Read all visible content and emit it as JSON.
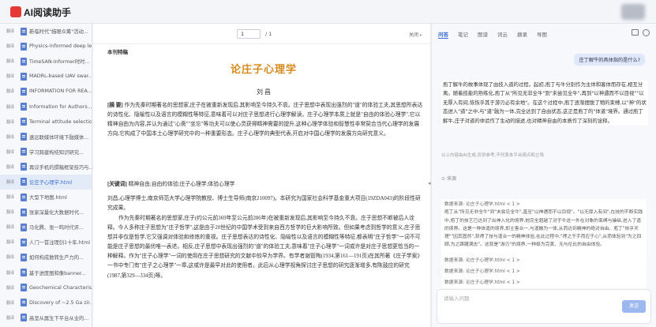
{
  "app": {
    "title": "AI阅读助手"
  },
  "sidebar": {
    "items": [
      {
        "tag": "翻译",
        "label": "新临时代\"描眼众筹\"活动..."
      },
      {
        "tag": "翻译",
        "label": "Physics-informed deep le..."
      },
      {
        "tag": "翻译",
        "label": "TimeSAN-Informer时时..."
      },
      {
        "tag": "翻译",
        "label": "MADRL-based UAV swar..."
      },
      {
        "tag": "翻译",
        "label": "INFORMATION FOR REA..."
      },
      {
        "tag": "翻译",
        "label": "Information for Authors..."
      },
      {
        "tag": "翻译",
        "label": "Terminal attitude selectio..."
      },
      {
        "tag": "翻译",
        "label": "速远联媒体环境下融媒体..."
      },
      {
        "tag": "翻译",
        "label": "学习跨建构结知识研究..."
      },
      {
        "tag": "翻译",
        "label": "再议手机的撰稿框架技巧与..."
      },
      {
        "tag": "翻译",
        "label": "论庄子心理学.html",
        "active": true
      },
      {
        "tag": "翻译",
        "label": "大型下地图.html"
      },
      {
        "tag": "翻译",
        "label": "张家深量化大数据时代..."
      },
      {
        "tag": "翻译",
        "label": "马化腾、张一鸣时代评..."
      },
      {
        "tag": "翻译",
        "label": "人门一首注理剑1十年.html"
      },
      {
        "tag": "翻译",
        "label": "如何构成数转生产力的..."
      },
      {
        "tag": "翻译",
        "label": "基于进度图和像banner..."
      },
      {
        "tag": "翻译",
        "label": "Geochemical Characteris..."
      },
      {
        "tag": "翻译",
        "label": "Discovery of ~2.5 Ga zir..."
      },
      {
        "tag": "翻译",
        "label": "高坚从属生下平台从业的..."
      }
    ]
  },
  "document": {
    "page_current": "1",
    "page_total": "/ 1",
    "close_label": "关闭",
    "journal": "本刊特稿",
    "title": "论庄子心理学",
    "author": "刘 昌",
    "abstract_label": "[摘 要]",
    "abstract": "作为先秦时期著名的思想家,庄子在被重新发现后,其影响至今持久不衰。庄子思想中表现出强烈的\"道\"的体验工夫,其思想所表达的诗性化、隐喻性以及语言的模糊性等特征,意味着可以对庄子思想进行心理学解读。庄子心理学本质上就是\"自由的体验心理学\",它以精神自由为内容,并认为通过\"心斋\"\"坐忘\"等功夫可以使心灵获得精神需要的提升,这种心理学体验和智慧性非常契合当代心理学的发展方向,它构成了中国本土心理学研究中的一种重要形态。庄子心理学的典型代表,开启对中国心理学的发展方向研究意义。",
    "keywords_label": "[关键词]",
    "keywords": "精神自由;自由的体验;庄子心理学;体验心理学",
    "author_info": "刘昌,心理学博士,南京师范大学心理学院教授、博士生导师(南京210097)。本研究为国家社会科学基金重大项目(19ZDA043)的阶段性研究成果。",
    "body": "作为先秦时期著名的思想家,庄子(约公元前369年至公元前286年)在被重新发现后,其影响至今持久不衰。庄子思想不断被后人诠释。今人多称庄子思想为\"庄子哲学\",这是由于20世纪的中国学术受到来自西方哲学的巨大影响所致。但如果考虑到哲学的意义,庄子思想并非仅是哲学,它又强调对体验和修炼的重视。庄子思想表达的诗性化、隐喻性以及语言的模糊性等特征,都表明\"庄子哲学\"一词不可能是庄子思想的最优唯一表述。相反,庄子思想中表现出强烈的\"道\"的体验工夫,意味着\"庄子心理学\"一词或许是对庄子思想更恰当的一种解释。作为\"庄子心理学\"一词的使用在庄子思想研究的文献中较早为学界。有学者谢管陶(1934,第161—191页)在其所著《庄子学案》一书中专门有\"庄子之心理学\"一章,这或许是最早对此的使用者。此后从心理学视角探讨庄子思想的研究逐渐增多,有陈鼓应的研究(1987,第329—334页)等。"
  },
  "chat": {
    "tabs": [
      "问答",
      "笔记",
      "图谱",
      "词云",
      "摘录",
      "导图"
    ],
    "question": "庄丁解牛的具体指的是什么?",
    "answer": "庖丁解牛的故事体现了由技入道的过程。起初,庖丁与牛分别作为主体和客体而存在,相互分离。随着技能的熟练化,庖丁从\"所见无非全牛\"到\"未尝见全牛\",再到\"以神遇而不以目视\"\"以无厚入有间,恢恢乎其于游刃必有余地\"。在这个过程中,庖丁逐渐摆脱了物的束缚,以\"神\"的状态进入\"道\"之中,与\"道\"融为一体,完全达到了自由状态,这正是庖丁的\"体道\"境界。通过庖丁解牛,庄子对道的体验作了生动的描述,也对精神自由的本质作了深刻的诠释。",
    "disclaimer": "以上内容由AI生成,仅供参考,不代表本平台观点和立场",
    "source_label": "来源",
    "refs": [
      {
        "title": "数据来源: 论庄子心理学.html  < 1 >",
        "text": "庖丁从\"所见无非全牛\"到\"未尝见全牛\",直至\"以神遇而不以目视\"。\"以无厚入有间\",在技的不断实践中,庖丁的技艺已达到了出神入化的境界,他完全超越了对于牛这一外在对象的束缚与操纵,进入了道的境界。这是一种体道的境界,即主客合一,与道融为一体,从而达到精神的绝对自由。庖丁\"依乎天理\"\"因其固然\",获得了技与道合一的精神体验,在此过程中,\"得之于手而应于心\",从而体验到\"为之四顾,为之踌躇满志\"。这就是\"游刃\"的境界,一种极为完美、无与伦比的自由体验。"
      },
      {
        "title": "数据来源: 论庄子心理学.html  < 1 >",
        "text": ""
      },
      {
        "title": "数据来源: 论庄子心理学.html  < 1 >",
        "text": ""
      },
      {
        "title": "数据来源: 论庄子心理学.html  < 1 >",
        "text": ""
      }
    ],
    "input_placeholder": "请输入问题",
    "send_label": "发送"
  },
  "colors": {
    "accent": "#3b6fd6",
    "title": "#d68a1a",
    "brand": "#e53935"
  }
}
